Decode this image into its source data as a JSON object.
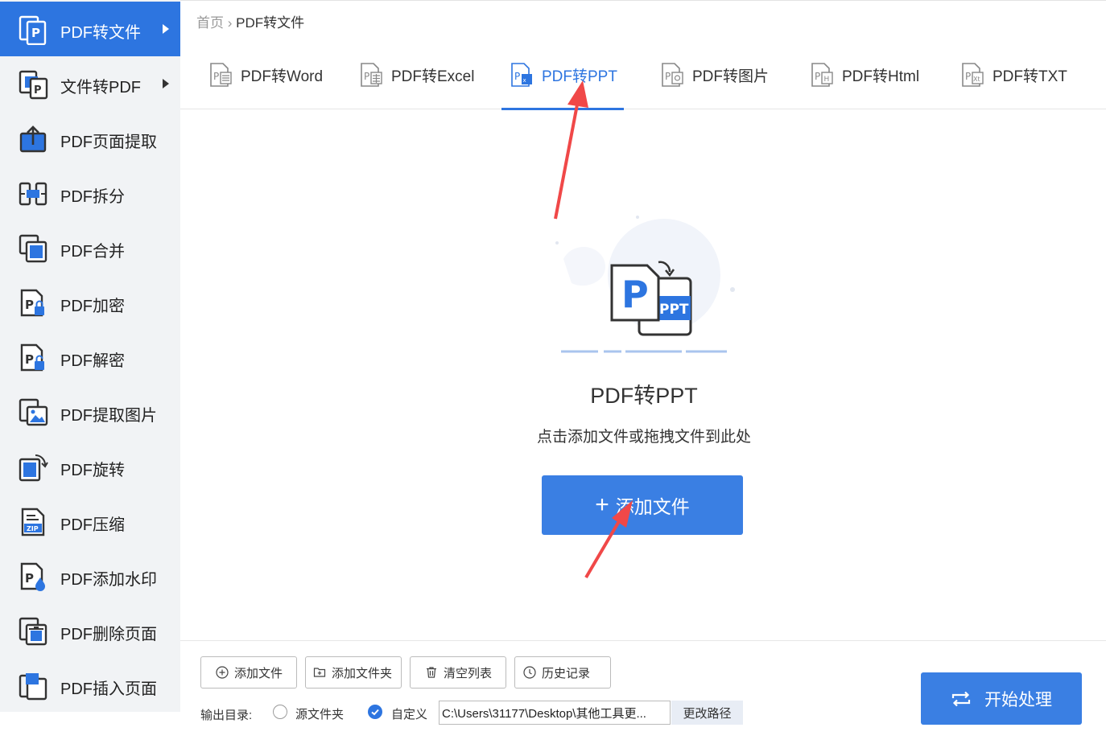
{
  "sidebar": {
    "items": [
      {
        "label": "PDF转文件",
        "icon": "pdf-to-file-icon",
        "has_arrow": true,
        "active": true
      },
      {
        "label": "文件转PDF",
        "icon": "file-to-pdf-icon",
        "has_arrow": true,
        "active": false
      },
      {
        "label": "PDF页面提取",
        "icon": "page-extract-icon",
        "has_arrow": false,
        "active": false
      },
      {
        "label": "PDF拆分",
        "icon": "split-icon",
        "has_arrow": false,
        "active": false
      },
      {
        "label": "PDF合并",
        "icon": "merge-icon",
        "has_arrow": false,
        "active": false
      },
      {
        "label": "PDF加密",
        "icon": "encrypt-lock-icon",
        "has_arrow": false,
        "active": false
      },
      {
        "label": "PDF解密",
        "icon": "decrypt-unlock-icon",
        "has_arrow": false,
        "active": false
      },
      {
        "label": "PDF提取图片",
        "icon": "extract-image-icon",
        "has_arrow": false,
        "active": false
      },
      {
        "label": "PDF旋转",
        "icon": "rotate-icon",
        "has_arrow": false,
        "active": false
      },
      {
        "label": "PDF压缩",
        "icon": "zip-compress-icon",
        "has_arrow": false,
        "active": false
      },
      {
        "label": "PDF添加水印",
        "icon": "watermark-icon",
        "has_arrow": false,
        "active": false
      },
      {
        "label": "PDF删除页面",
        "icon": "delete-page-icon",
        "has_arrow": false,
        "active": false
      },
      {
        "label": "PDF插入页面",
        "icon": "insert-page-icon",
        "has_arrow": false,
        "active": false
      }
    ]
  },
  "breadcrumb": {
    "home": "首页",
    "separator": "›",
    "current": "PDF转文件"
  },
  "tabs": [
    {
      "label": "PDF转Word",
      "icon": "pdf-word-icon",
      "active": false
    },
    {
      "label": "PDF转Excel",
      "icon": "pdf-excel-icon",
      "active": false
    },
    {
      "label": "PDF转PPT",
      "icon": "pdf-ppt-icon",
      "active": true
    },
    {
      "label": "PDF转图片",
      "icon": "pdf-image-icon",
      "active": false
    },
    {
      "label": "PDF转Html",
      "icon": "pdf-html-icon",
      "active": false
    },
    {
      "label": "PDF转TXT",
      "icon": "pdf-txt-icon",
      "active": false
    }
  ],
  "center": {
    "title": "PDF转PPT",
    "hint": "点击添加文件或拖拽文件到此处",
    "add_button": "添加文件",
    "hero_letter": "P",
    "hero_badge": "PPT"
  },
  "toolbar": {
    "add_file": "添加文件",
    "add_folder": "添加文件夹",
    "clear_list": "清空列表",
    "history": "历史记录"
  },
  "output": {
    "label": "输出目录:",
    "option_source": "源文件夹",
    "option_custom": "自定义",
    "selected": "custom",
    "path": "C:\\Users\\31177\\Desktop\\其他工具更...",
    "change_path": "更改路径"
  },
  "start_button": "开始处理",
  "colors": {
    "accent": "#2d75e0",
    "annotation": "#f04848",
    "sidebar_bg": "#f1f3f5"
  }
}
